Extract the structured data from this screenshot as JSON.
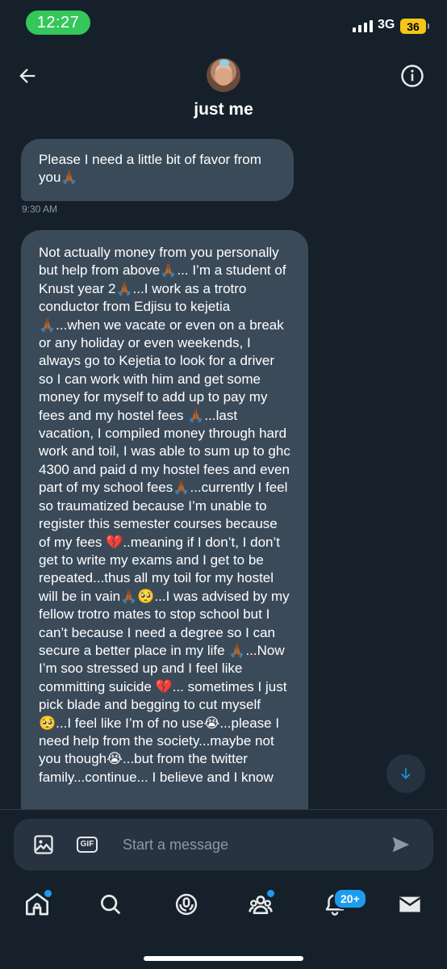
{
  "status_bar": {
    "time": "12:27",
    "network": "3G",
    "battery": "36"
  },
  "header": {
    "title": "just me"
  },
  "messages": [
    {
      "text": "Please I need a little bit of favor from you🙏🏾",
      "time": "9:30 AM"
    },
    {
      "text": "Not actually money from you personally but help from above🙏🏾... I’m a student of Knust year 2🙏🏾...I work as a trotro conductor from Edjisu to kejetia🙏🏾...when we vacate or even on a break or any holiday or even weekends, I always go to Kejetia to look for a driver so I can work with him and get some money for myself to add up to pay my fees and my hostel fees 🙏🏾...last vacation, I compiled money through hard work and toil, I was able to sum up to ghc 4300 and paid d my hostel fees and even part of my school fees🙏🏾...currently I feel so traumatized because I’m unable to register this semester courses because of my fees 💔..meaning if I don’t, I don’t get to write my exams and I get to be repeated...thus all my toil for my hostel will be in vain🙏🏾🥺...I was advised by my fellow trotro mates to stop school but I can’t because I need a degree so I can secure a better place in my life 🙏🏾...Now I’m soo stressed up and I feel like committing suicide 💔... sometimes I just pick blade and begging to cut myself 🥺...I feel like I’m of no use😭...please I need help from the society...maybe not you though😭...but from the twitter family...continue... I believe and I know"
    }
  ],
  "composer": {
    "placeholder": "Start a message",
    "gif_label": "GIF"
  },
  "nav": {
    "notifications_badge": "20+"
  },
  "colors": {
    "background": "#15202b",
    "bubble": "#3b4a59",
    "accent": "#1d9bf0",
    "status_pill": "#34c759",
    "battery": "#f5c518"
  }
}
